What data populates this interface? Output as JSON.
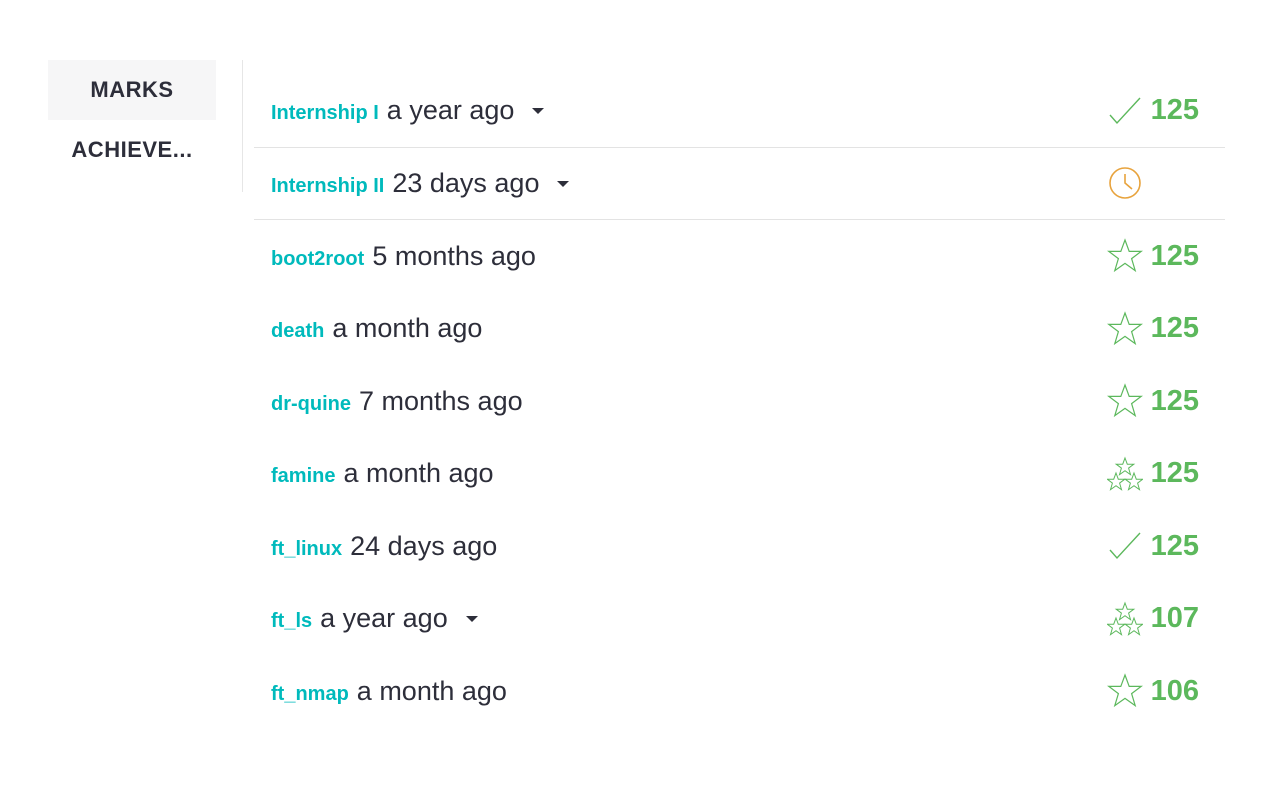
{
  "sidebar": {
    "tabs": [
      {
        "label": "MARKS"
      },
      {
        "label": "ACHIEVE..."
      }
    ]
  },
  "projects": [
    {
      "name": "Internship I",
      "time": "a year ago",
      "expandable": true,
      "status_icon": "check-icon",
      "mark": "125"
    },
    {
      "name": "Internship II",
      "time": "23 days ago",
      "expandable": true,
      "status_icon": "clock-icon",
      "mark": ""
    },
    {
      "name": "boot2root",
      "time": "5 months ago",
      "expandable": false,
      "status_icon": "star-icon",
      "mark": "125"
    },
    {
      "name": "death",
      "time": "a month ago",
      "expandable": false,
      "status_icon": "star-icon",
      "mark": "125"
    },
    {
      "name": "dr-quine",
      "time": "7 months ago",
      "expandable": false,
      "status_icon": "star-icon",
      "mark": "125"
    },
    {
      "name": "famine",
      "time": "a month ago",
      "expandable": false,
      "status_icon": "three-stars-icon",
      "mark": "125"
    },
    {
      "name": "ft_linux",
      "time": "24 days ago",
      "expandable": false,
      "status_icon": "check-icon",
      "mark": "125"
    },
    {
      "name": "ft_ls",
      "time": "a year ago",
      "expandable": true,
      "status_icon": "three-stars-icon",
      "mark": "107"
    },
    {
      "name": "ft_nmap",
      "time": "a month ago",
      "expandable": false,
      "status_icon": "star-icon",
      "mark": "106"
    }
  ],
  "colors": {
    "accent": "#00babc",
    "success": "#5cb85c",
    "pending": "#e8a33d",
    "text": "#2d2e3a"
  }
}
